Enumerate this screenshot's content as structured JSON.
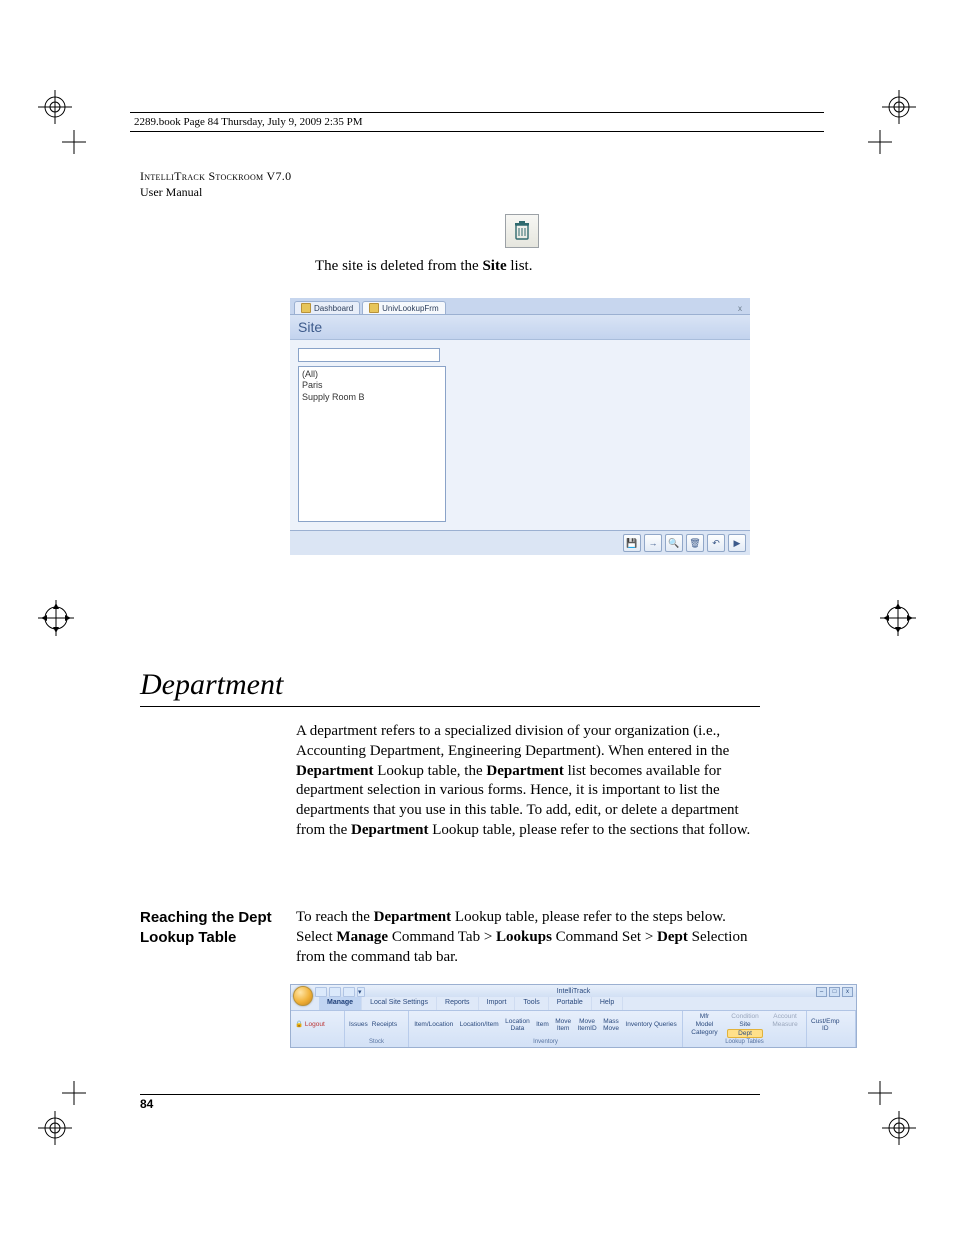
{
  "running_head": "2289.book  Page 84  Thursday, July 9, 2009  2:35 PM",
  "header": {
    "product": "IntelliTrack Stockroom V7.0",
    "subtitle": "User Manual"
  },
  "delete_sentence": {
    "pre": "The site is deleted from the ",
    "bold": "Site",
    "post": " list."
  },
  "shot1": {
    "tabs": [
      "Dashboard",
      "UnivLookupFrm"
    ],
    "close_x": "x",
    "title": "Site",
    "list_items": [
      "(All)",
      "Paris",
      "Supply Room B"
    ],
    "bottom_icons": [
      "💾",
      "→",
      "🔍",
      "🗑",
      "↶",
      "▶"
    ]
  },
  "section_heading": "Department",
  "para1_parts": [
    {
      "t": "A department refers to a specialized division of your organization (i.e., Accounting Department, Engineering Department). When entered in the "
    },
    {
      "t": "Department",
      "b": true
    },
    {
      "t": " Lookup table, the "
    },
    {
      "t": "Department",
      "b": true
    },
    {
      "t": " list becomes available for department selection in various forms. Hence, it is important to list the departments that you use in this table. To add, edit, or delete a department from the "
    },
    {
      "t": "Department",
      "b": true
    },
    {
      "t": " Lookup table, please refer to the sections that follow."
    }
  ],
  "sidehead": "Reaching the Dept Lookup Table",
  "para2_parts": [
    {
      "t": "To reach the "
    },
    {
      "t": "Department",
      "b": true
    },
    {
      "t": " Lookup table, please refer to the steps below. Select "
    },
    {
      "t": "Manage",
      "b": true
    },
    {
      "t": " Command Tab > "
    },
    {
      "t": "Lookups",
      "b": true
    },
    {
      "t": " Command Set > "
    },
    {
      "t": "Dept",
      "b": true
    },
    {
      "t": " Selection from the command tab bar."
    }
  ],
  "shot2": {
    "title": "IntelliTrack",
    "win_buttons": [
      "–",
      "□",
      "x"
    ],
    "tabs": [
      "Manage",
      "Local Site Settings",
      "Reports",
      "Import",
      "Tools",
      "Portable",
      "Help"
    ],
    "active_tab": "Manage",
    "logout": "Logout",
    "stock_group": {
      "items": [
        "Issues",
        "Receipts"
      ],
      "label": "Stock"
    },
    "inv_group": {
      "items": [
        "Item/Location",
        "Location/Item",
        "Location Data",
        "Item",
        "Move Item",
        "Move ItemID",
        "Mass Move",
        "Inventory Queries"
      ],
      "label": "Inventory"
    },
    "lookup_group": {
      "row1": [
        "Mfr",
        "Condition",
        "Account"
      ],
      "row2": [
        "Model",
        "Site",
        "Measure"
      ],
      "row3": [
        "Category",
        "Dept",
        ""
      ],
      "dim": [
        "Condition",
        "Account",
        "Measure"
      ],
      "hl": "Dept",
      "label": "Lookup Tables"
    },
    "cust_group": {
      "items": [
        "Cust/Emp ID"
      ],
      "label": ""
    }
  },
  "page_number": "84"
}
